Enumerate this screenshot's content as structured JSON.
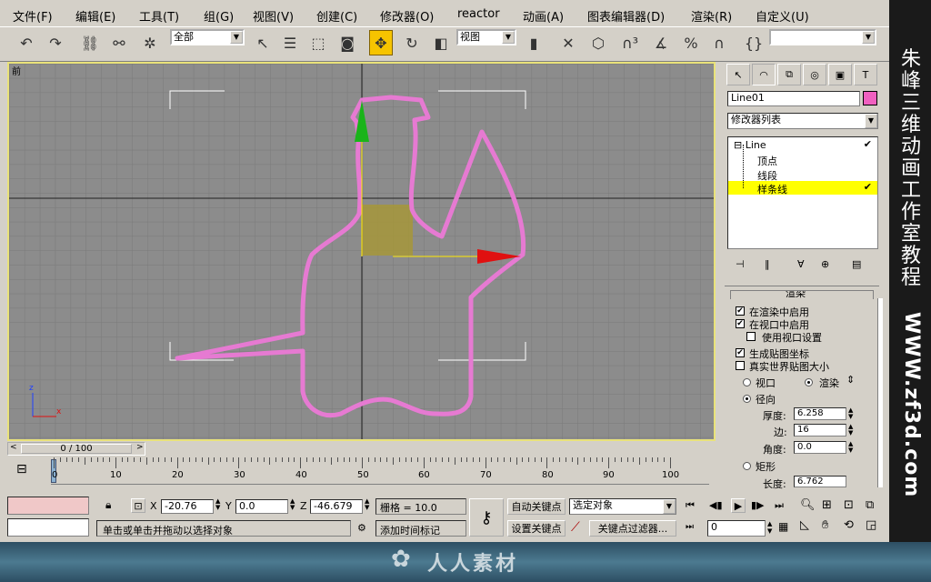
{
  "menu": [
    "文件(F)",
    "编辑(E)",
    "工具(T)",
    "组(G)",
    "视图(V)",
    "创建(C)",
    "修改器(O)",
    "reactor",
    "动画(A)",
    "图表编辑器(D)",
    "渲染(R)",
    "自定义(U)"
  ],
  "toolbar": {
    "selection_filter": "全部",
    "ref_coord": "视图",
    "named_sel": ""
  },
  "viewport": {
    "label": "前",
    "axis_z": "z",
    "axis_x": "x"
  },
  "cmd": {
    "object_name": "Line01",
    "object_color": "#f060c0",
    "modifier_list": "修改器列表",
    "stack": [
      "Line",
      "顶点",
      "线段",
      "样条线"
    ],
    "rollout_title": "渲染",
    "options": {
      "render_enable": "在渲染中启用",
      "viewport_enable": "在视口中启用",
      "use_viewport": "使用视口设置",
      "gen_mapping": "生成贴图坐标",
      "real_world": "真实世界贴图大小",
      "viewport_radio": "视口",
      "render_radio": "渲染",
      "radial": "径向",
      "thickness_label": "厚度:",
      "thickness": "6.258",
      "sides_label": "边:",
      "sides": "16",
      "angle_label": "角度:",
      "angle": "0.0",
      "rect": "矩形",
      "length_label": "长度:",
      "length": "6.762"
    }
  },
  "timeline": {
    "frame": "0 / 100",
    "ticks": [
      "0",
      "10",
      "20",
      "30",
      "40",
      "50",
      "60",
      "70",
      "80",
      "90",
      "100"
    ]
  },
  "status": {
    "x_label": "X",
    "x": "-20.76",
    "y_label": "Y",
    "y": "0.0",
    "z_label": "Z",
    "z": "-46.679",
    "grid": "栅格 = 10.0",
    "auto_key": "自动关键点",
    "set_key": "设置关键点",
    "key_select": "选定对象",
    "key_filter": "关键点过滤器...",
    "prompt": "单击或单击并拖动以选择对象",
    "add_tag": "添加时间标记",
    "frame_field": "0"
  },
  "brand": {
    "title": "朱峰三维动画工作室教程",
    "url": "WWW.zf3d.com"
  },
  "watermark": "人人素材"
}
